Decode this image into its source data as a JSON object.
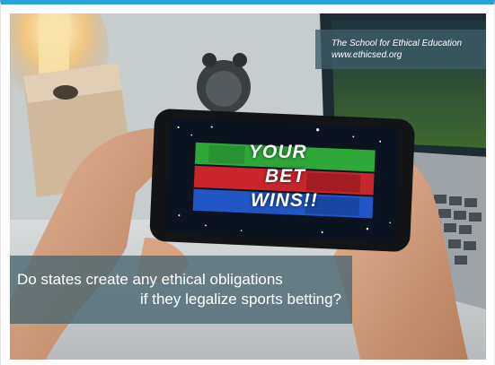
{
  "credit": {
    "name": "The School for Ethical Education",
    "url": "www.ethicsed.org"
  },
  "phone_screen": {
    "line1": "YOUR",
    "line2": "BET",
    "line3": "WINS!!"
  },
  "caption": {
    "line1": "Do states create any ethical obligations",
    "line2": "if they legalize sports betting?"
  },
  "colors": {
    "frame_accent": "#29a3d6",
    "banner_green": "#2fa83a",
    "banner_red": "#c8262b",
    "banner_blue": "#2156c4"
  }
}
